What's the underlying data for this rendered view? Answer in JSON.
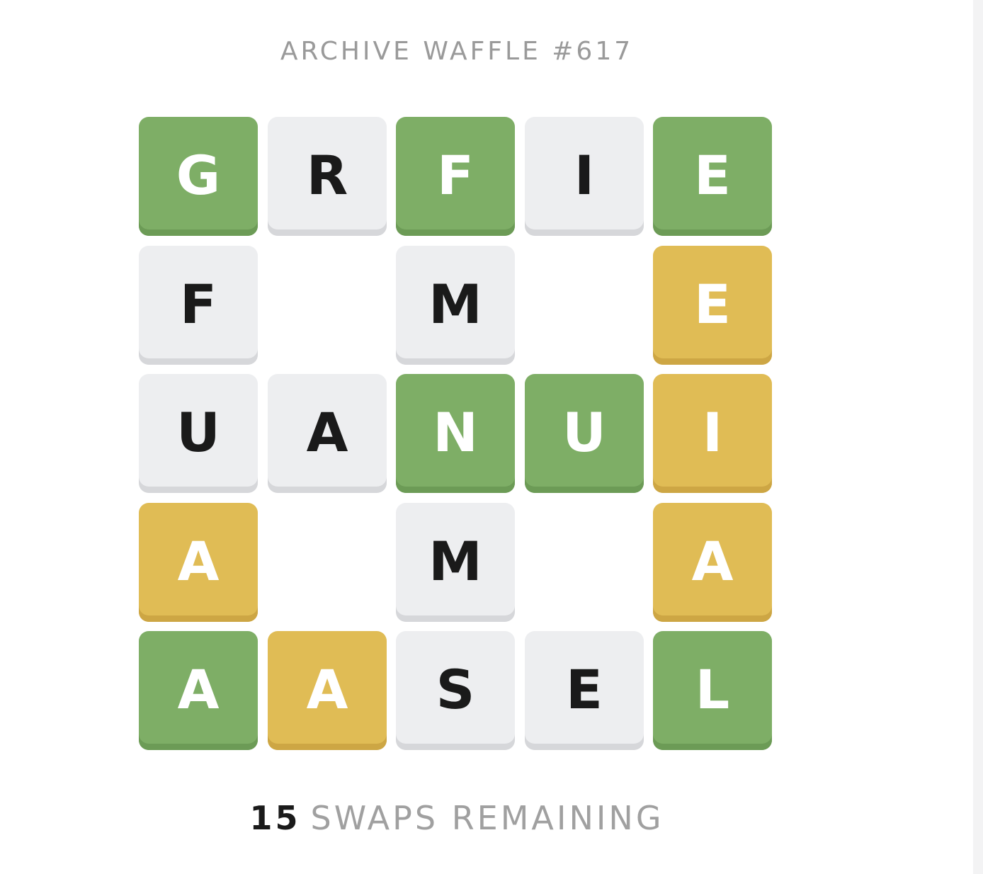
{
  "title": "ARCHIVE WAFFLE #617",
  "board": {
    "rows": [
      [
        {
          "letter": "G",
          "state": "green"
        },
        {
          "letter": "R",
          "state": "grey"
        },
        {
          "letter": "F",
          "state": "green"
        },
        {
          "letter": "I",
          "state": "grey"
        },
        {
          "letter": "E",
          "state": "green"
        }
      ],
      [
        {
          "letter": "F",
          "state": "grey"
        },
        null,
        {
          "letter": "M",
          "state": "grey"
        },
        null,
        {
          "letter": "E",
          "state": "yellow"
        }
      ],
      [
        {
          "letter": "U",
          "state": "grey"
        },
        {
          "letter": "A",
          "state": "grey"
        },
        {
          "letter": "N",
          "state": "green"
        },
        {
          "letter": "U",
          "state": "green"
        },
        {
          "letter": "I",
          "state": "yellow"
        }
      ],
      [
        {
          "letter": "A",
          "state": "yellow"
        },
        null,
        {
          "letter": "M",
          "state": "grey"
        },
        null,
        {
          "letter": "A",
          "state": "yellow"
        }
      ],
      [
        {
          "letter": "A",
          "state": "green"
        },
        {
          "letter": "A",
          "state": "yellow"
        },
        {
          "letter": "S",
          "state": "grey"
        },
        {
          "letter": "E",
          "state": "grey"
        },
        {
          "letter": "L",
          "state": "green"
        }
      ]
    ]
  },
  "swaps": {
    "count": "15",
    "label": "SWAPS REMAINING"
  },
  "colors": {
    "green": "#7eae66",
    "yellow": "#e0bc55",
    "grey": "#edeef0"
  }
}
